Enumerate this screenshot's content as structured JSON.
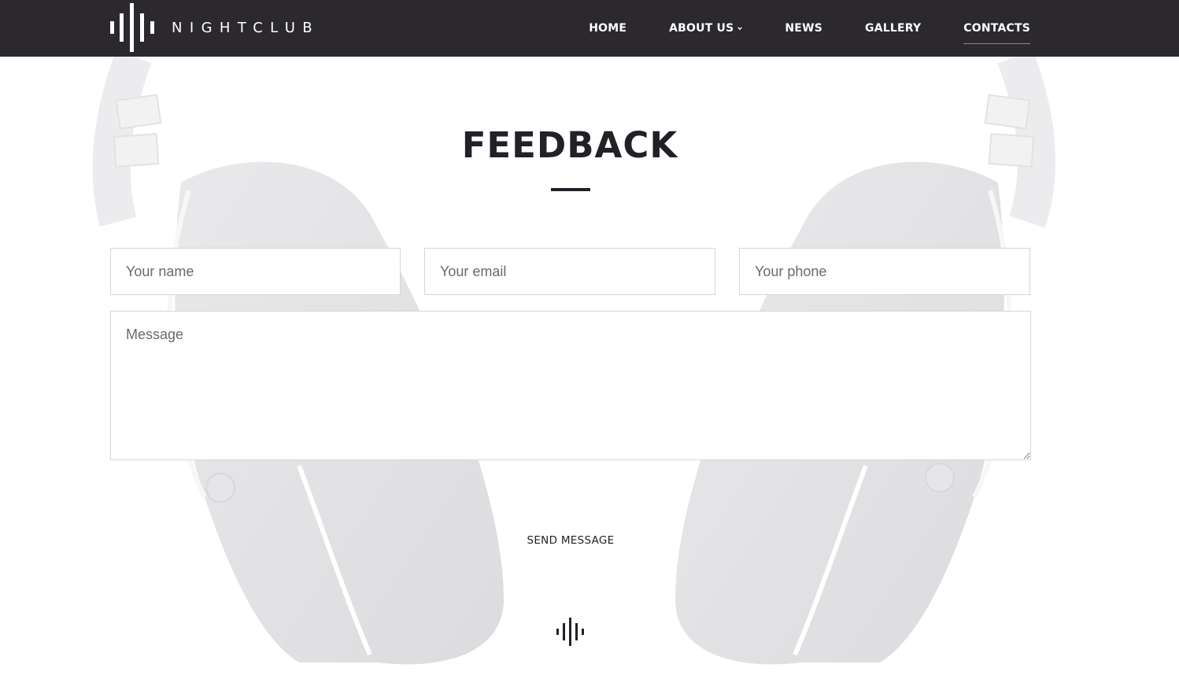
{
  "brand": {
    "name": "NIGHTCLUB",
    "logo_icon": "sound-wave-bars-icon"
  },
  "nav": {
    "items": [
      {
        "label": "HOME"
      },
      {
        "label": "ABOUT US",
        "has_dropdown": true
      },
      {
        "label": "NEWS"
      },
      {
        "label": "GALLERY"
      },
      {
        "label": "CONTACTS",
        "active": true
      }
    ]
  },
  "feedback": {
    "title": "FEEDBACK",
    "name_placeholder": "Your name",
    "email_placeholder": "Your email",
    "phone_placeholder": "Your phone",
    "message_placeholder": "Message",
    "send_label": "SEND MESSAGE"
  },
  "footer": {
    "icon": "sound-wave-bars-icon"
  },
  "colors": {
    "header_bg": "#2b292d",
    "text_dark": "#232127",
    "page_bg": "#ffffff",
    "field_border": "#d6d6d6"
  }
}
